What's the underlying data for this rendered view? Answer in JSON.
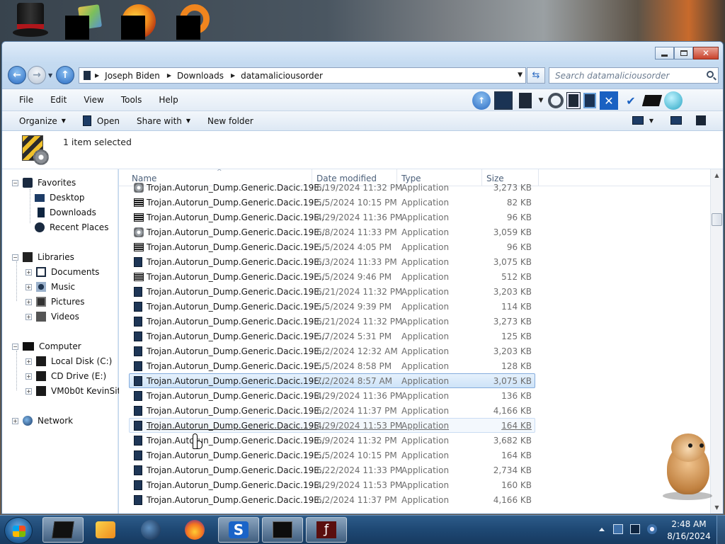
{
  "desktop": {
    "icons": [
      "top-hat-icon",
      "folders-icon",
      "orb-icon",
      "ring-icon"
    ]
  },
  "window": {
    "address": {
      "breadcrumbs": [
        "Joseph Biden",
        "Downloads",
        "datamaliciousorder"
      ]
    },
    "search": {
      "placeholder": "Search datamaliciousorder"
    },
    "menu": [
      "File",
      "Edit",
      "View",
      "Tools",
      "Help"
    ],
    "commands": {
      "organize": "Organize",
      "open": "Open",
      "share_with": "Share with",
      "new_folder": "New folder"
    },
    "details": {
      "selected": "1 item selected"
    },
    "nav": {
      "favorites": "Favorites",
      "desktop": "Desktop",
      "downloads": "Downloads",
      "recent_places": "Recent Places",
      "libraries": "Libraries",
      "documents": "Documents",
      "music": "Music",
      "pictures": "Pictures",
      "videos": "Videos",
      "computer": "Computer",
      "local_disk": "Local Disk (C:)",
      "cd_drive": "CD Drive (E:)",
      "vm_share": "VM0b0t KevinSite",
      "network": "Network"
    },
    "columns": {
      "name": "Name",
      "date": "Date modified",
      "type": "Type",
      "size": "Size"
    },
    "files": [
      {
        "name": "Trojan.Autorun_Dump.Generic.Dacic.19E...",
        "date": "6/19/2024 11:32 PM",
        "type": "Application",
        "size": "3,273 KB",
        "icon": "gear"
      },
      {
        "name": "Trojan.Autorun_Dump.Generic.Dacic.19E...",
        "date": "5/5/2024 10:15 PM",
        "type": "Application",
        "size": "82 KB",
        "icon": "console"
      },
      {
        "name": "Trojan.Autorun_Dump.Generic.Dacic.19E...",
        "date": "4/29/2024 11:36 PM",
        "type": "Application",
        "size": "96 KB",
        "icon": "console"
      },
      {
        "name": "Trojan.Autorun_Dump.Generic.Dacic.19E...",
        "date": "6/8/2024 11:33 PM",
        "type": "Application",
        "size": "3,059 KB",
        "icon": "gear"
      },
      {
        "name": "Trojan.Autorun_Dump.Generic.Dacic.19E...",
        "date": "5/5/2024 4:05 PM",
        "type": "Application",
        "size": "96 KB",
        "icon": "console"
      },
      {
        "name": "Trojan.Autorun_Dump.Generic.Dacic.19E...",
        "date": "6/3/2024 11:33 PM",
        "type": "Application",
        "size": "3,075 KB",
        "icon": "app"
      },
      {
        "name": "Trojan.Autorun_Dump.Generic.Dacic.19E...",
        "date": "5/5/2024 9:46 PM",
        "type": "Application",
        "size": "512 KB",
        "icon": "console"
      },
      {
        "name": "Trojan.Autorun_Dump.Generic.Dacic.19E...",
        "date": "6/21/2024 11:32 PM",
        "type": "Application",
        "size": "3,203 KB",
        "icon": "app"
      },
      {
        "name": "Trojan.Autorun_Dump.Generic.Dacic.19E...",
        "date": "5/5/2024 9:39 PM",
        "type": "Application",
        "size": "114 KB",
        "icon": "app"
      },
      {
        "name": "Trojan.Autorun_Dump.Generic.Dacic.19E...",
        "date": "6/21/2024 11:32 PM",
        "type": "Application",
        "size": "3,273 KB",
        "icon": "app"
      },
      {
        "name": "Trojan.Autorun_Dump.Generic.Dacic.19E...",
        "date": "5/7/2024 5:31 PM",
        "type": "Application",
        "size": "125 KB",
        "icon": "app"
      },
      {
        "name": "Trojan.Autorun_Dump.Generic.Dacic.19E...",
        "date": "6/2/2024 12:32 AM",
        "type": "Application",
        "size": "3,203 KB",
        "icon": "app"
      },
      {
        "name": "Trojan.Autorun_Dump.Generic.Dacic.19E...",
        "date": "5/5/2024 8:58 PM",
        "type": "Application",
        "size": "128 KB",
        "icon": "app"
      },
      {
        "name": "Trojan.Autorun_Dump.Generic.Dacic.19E...",
        "date": "7/2/2024 8:57 AM",
        "type": "Application",
        "size": "3,075 KB",
        "icon": "app",
        "state": "selected"
      },
      {
        "name": "Trojan.Autorun_Dump.Generic.Dacic.19E...",
        "date": "4/29/2024 11:36 PM",
        "type": "Application",
        "size": "136 KB",
        "icon": "app"
      },
      {
        "name": "Trojan.Autorun_Dump.Generic.Dacic.19E...",
        "date": "6/2/2024 11:37 PM",
        "type": "Application",
        "size": "4,166 KB",
        "icon": "app"
      },
      {
        "name": "Trojan.Autorun_Dump.Generic.Dacic.19E...",
        "date": "4/29/2024 11:53 PM",
        "type": "Application",
        "size": "164 KB",
        "icon": "app",
        "state": "hover"
      },
      {
        "name": "Trojan.Autorun_Dump.Generic.Dacic.19E...",
        "date": "6/9/2024 11:32 PM",
        "type": "Application",
        "size": "3,682 KB",
        "icon": "app"
      },
      {
        "name": "Trojan.Autorun_Dump.Generic.Dacic.19E...",
        "date": "5/5/2024 10:15 PM",
        "type": "Application",
        "size": "164 KB",
        "icon": "app"
      },
      {
        "name": "Trojan.Autorun_Dump.Generic.Dacic.19E...",
        "date": "6/22/2024 11:33 PM",
        "type": "Application",
        "size": "2,734 KB",
        "icon": "app"
      },
      {
        "name": "Trojan.Autorun_Dump.Generic.Dacic.19E...",
        "date": "4/29/2024 11:53 PM",
        "type": "Application",
        "size": "160 KB",
        "icon": "app"
      },
      {
        "name": "Trojan.Autorun_Dump.Generic.Dacic.19E...",
        "date": "6/2/2024 11:37 PM",
        "type": "Application",
        "size": "4,166 KB",
        "icon": "app"
      }
    ]
  },
  "taskbar": {
    "apps": [
      "explorer-icon",
      "media-player-icon",
      "globe-icon",
      "firefox-icon",
      "s-app-icon",
      "terminal-icon",
      "flash-icon"
    ],
    "time": "2:48 AM",
    "date": "8/16/2024"
  },
  "colors": {
    "selection": "#cde3f8",
    "taskbar": "#1e4873",
    "window_frame": "#c4d9ef"
  }
}
